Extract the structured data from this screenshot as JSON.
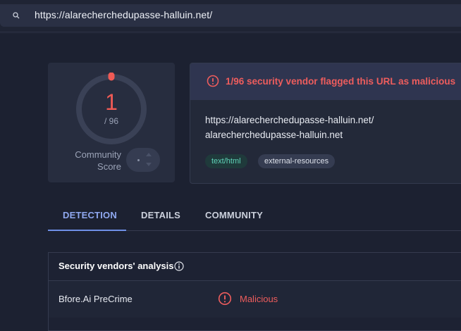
{
  "search": {
    "url": "https://alarecherchedupasse-halluin.net/"
  },
  "score": {
    "value": "1",
    "total": "/ 96",
    "community_label": "Community Score"
  },
  "summary": {
    "alert": "1/96 security vendor flagged this URL as malicious",
    "url": "https://alarecherchedupasse-halluin.net/",
    "domain": "alarecherchedupasse-halluin.net",
    "tags": [
      "text/html",
      "external-resources"
    ]
  },
  "tabs": [
    {
      "label": "DETECTION",
      "active": true
    },
    {
      "label": "DETAILS",
      "active": false
    },
    {
      "label": "COMMUNITY",
      "active": false
    }
  ],
  "analysis": {
    "title": "Security vendors' analysis",
    "rows": [
      {
        "vendor": "Bfore.Ai PreCrime",
        "result": "Malicious"
      }
    ]
  },
  "colors": {
    "malicious": "#ee5d5d",
    "accent": "#6e8fe6",
    "tag_text_html": "#5fd3b8"
  }
}
